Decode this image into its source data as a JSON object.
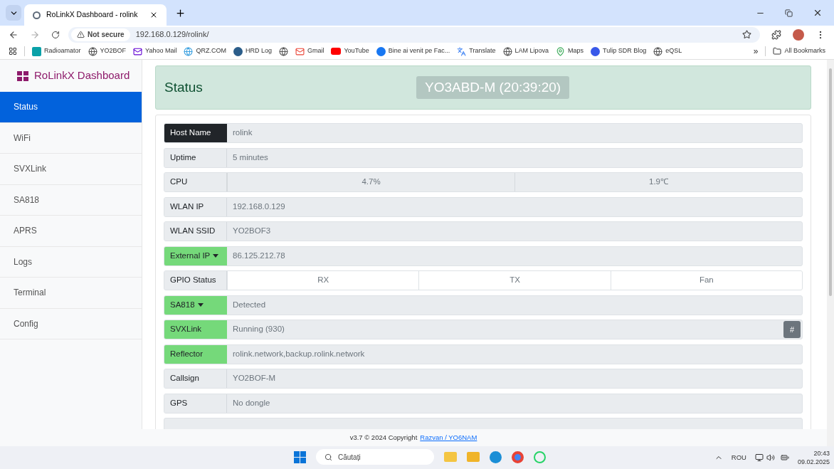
{
  "browser": {
    "tabs": [
      {
        "title": "RoLinkX Dashboard - rolink",
        "selected": true
      }
    ],
    "security": "Not secure",
    "url": "192.168.0.129/rolink/",
    "bookmarks": [
      "Radioamator",
      "YO2BOF",
      "Yahoo Mail",
      "QRZ.COM",
      "HRD Log",
      "Gmail",
      "YouTube",
      "Bine ai venit pe Fac...",
      "Translate",
      "LAM Lipova",
      "Maps",
      "Tulip SDR Blog",
      "eQSL"
    ],
    "overflow": "»",
    "all_bookmarks": "All Bookmarks"
  },
  "sidebar": {
    "brand": "RoLinkX Dashboard",
    "items": [
      {
        "label": "Status",
        "selected": true
      },
      {
        "label": "WiFi",
        "selected": false
      },
      {
        "label": "SVXLink",
        "selected": false
      },
      {
        "label": "SA818",
        "selected": false
      },
      {
        "label": "APRS",
        "selected": false
      },
      {
        "label": "Logs",
        "selected": false
      },
      {
        "label": "Terminal",
        "selected": false
      },
      {
        "label": "Config",
        "selected": false
      }
    ]
  },
  "header": {
    "title": "Status",
    "badge": "YO3ABD-M (20:39:20)"
  },
  "rows": [
    {
      "label": "Host Name",
      "kind": "dark",
      "dropdown": false,
      "values": [
        "rolink"
      ]
    },
    {
      "label": "Uptime",
      "kind": "plain",
      "dropdown": false,
      "values": [
        "5 minutes"
      ]
    },
    {
      "label": "CPU",
      "kind": "split",
      "dropdown": false,
      "values": [
        "4.7%",
        "1.9℃"
      ]
    },
    {
      "label": "WLAN IP",
      "kind": "plain",
      "dropdown": false,
      "values": [
        "192.168.0.129"
      ]
    },
    {
      "label": "WLAN SSID",
      "kind": "plain",
      "dropdown": false,
      "values": [
        "YO2BOF3"
      ]
    },
    {
      "label": "External IP",
      "kind": "green",
      "dropdown": true,
      "values": [
        "86.125.212.78"
      ]
    },
    {
      "label": "GPIO Status",
      "kind": "indicators",
      "dropdown": false,
      "values": [
        "RX",
        "TX",
        "Fan"
      ]
    },
    {
      "label": "SA818",
      "kind": "green",
      "dropdown": true,
      "values": [
        "Detected"
      ]
    },
    {
      "label": "SVXLink",
      "kind": "green",
      "dropdown": false,
      "values": [
        "Running (930)"
      ],
      "action": "#"
    },
    {
      "label": "Reflector",
      "kind": "green",
      "dropdown": false,
      "values": [
        "rolink.network,backup.rolink.network"
      ]
    },
    {
      "label": "Callsign",
      "kind": "plain",
      "dropdown": false,
      "values": [
        "YO2BOF-M"
      ]
    },
    {
      "label": "GPS",
      "kind": "plain",
      "dropdown": false,
      "values": [
        "No dongle"
      ]
    }
  ],
  "footer": {
    "text": "v3.7 © 2024 Copyright",
    "link": "Razvan / YO6NAM"
  },
  "taskbar": {
    "search_placeholder": "Căutați",
    "language": "ROU",
    "time": "20:43",
    "date": "09.02.2025"
  }
}
